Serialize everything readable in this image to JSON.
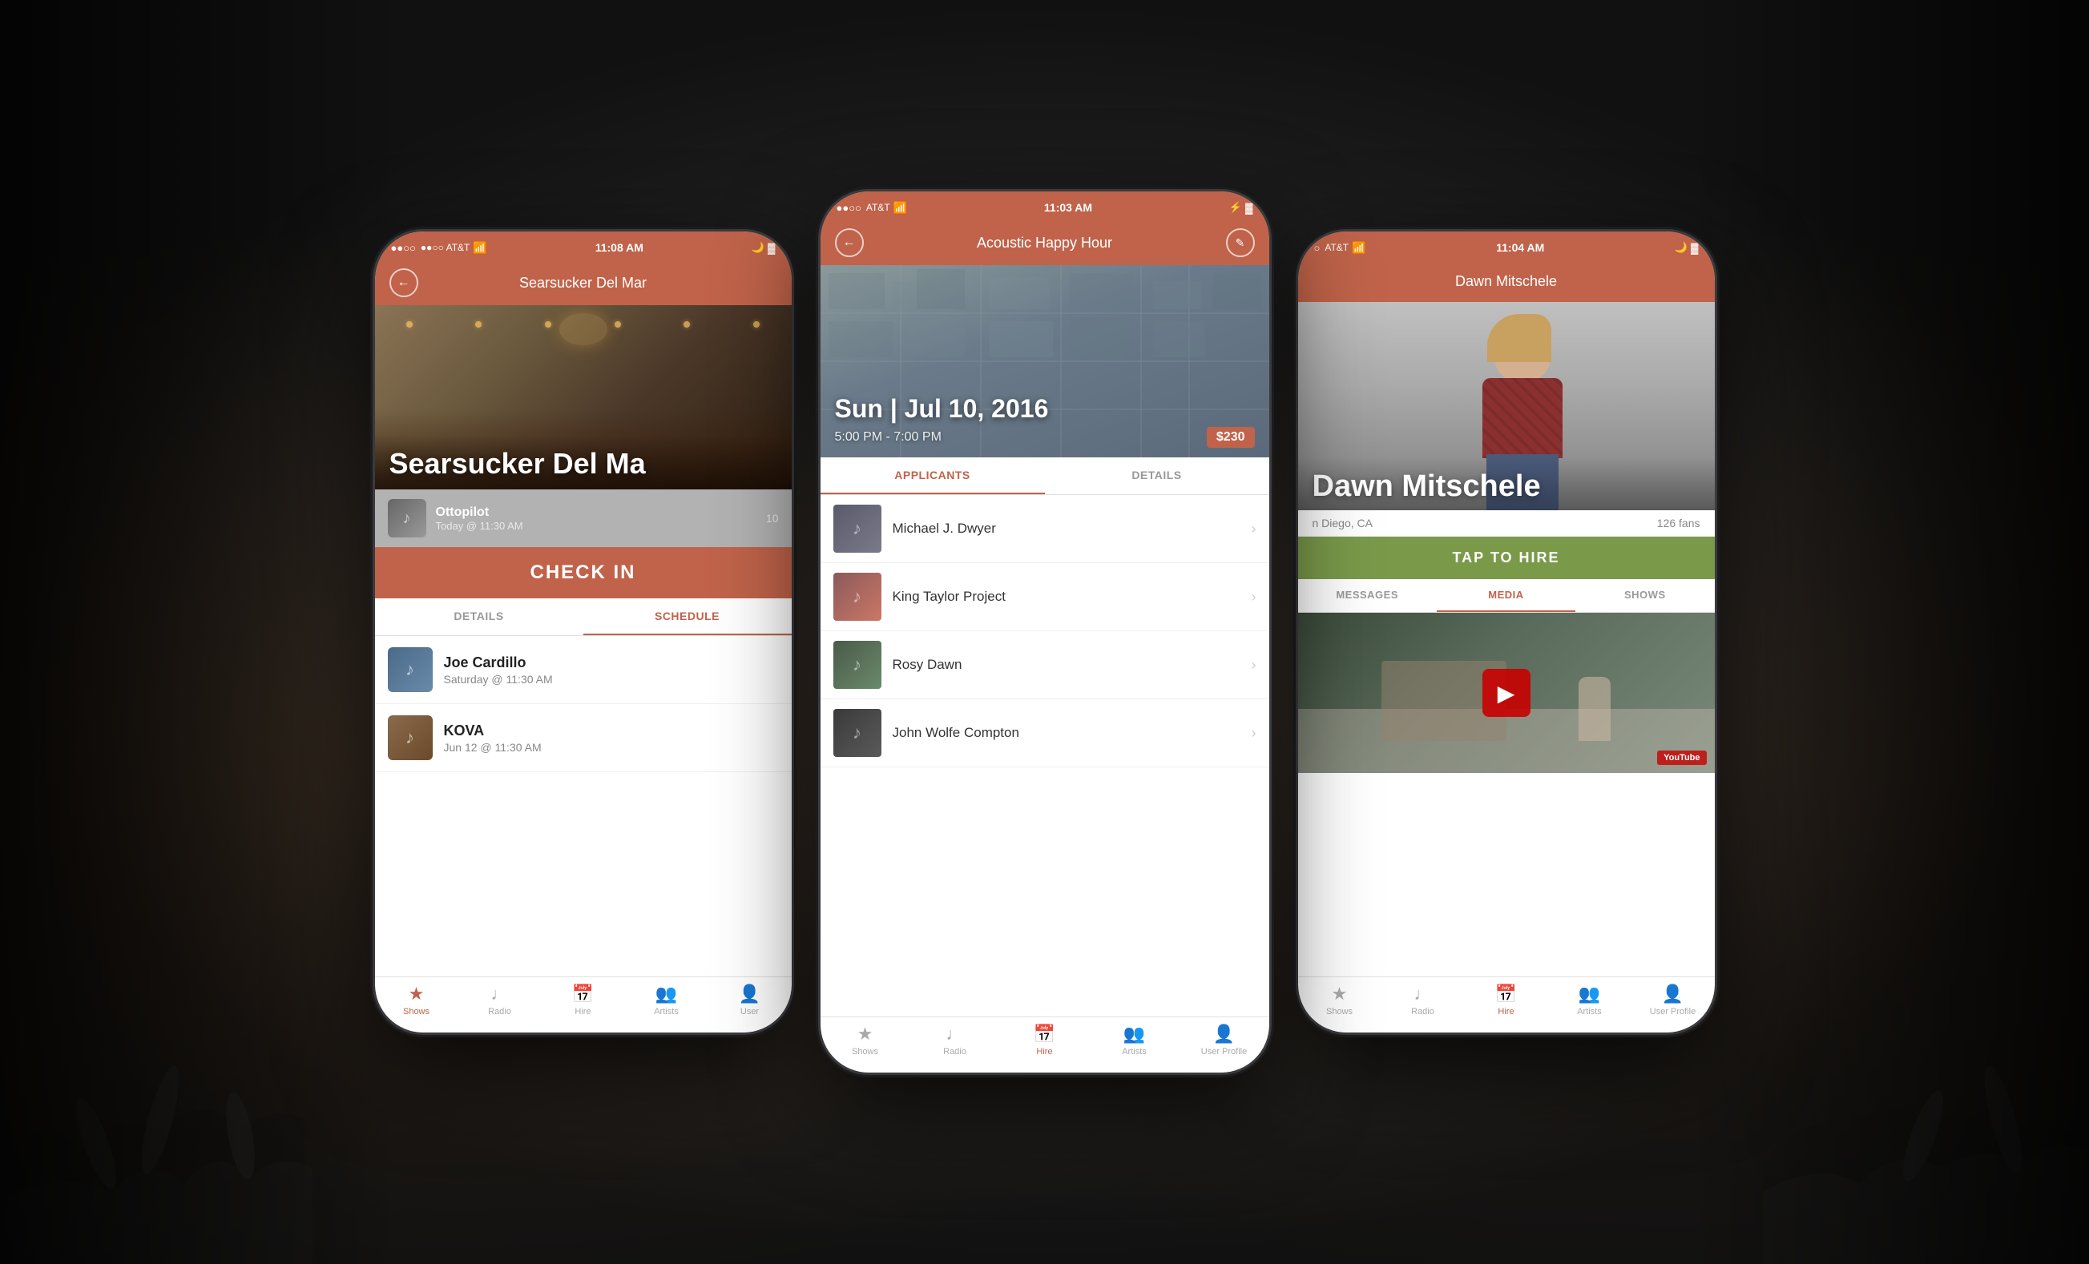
{
  "background": {
    "color": "#1a1a1a"
  },
  "phones": {
    "left": {
      "statusBar": {
        "carrier": "●●○○ AT&T",
        "wifi": "▲",
        "time": "11:08 AM",
        "battery": "🔋"
      },
      "navBar": {
        "backLabel": "←",
        "title": "Searsucker Del Mar"
      },
      "heroVenueName": "Searsucker Del Ma",
      "performerSection": {
        "name": "Ottopilot",
        "time": "Today @ 11:30 AM",
        "count": "10"
      },
      "checkInBtn": "CHECK IN",
      "tabs": [
        {
          "label": "DETAILS",
          "active": false
        },
        {
          "label": "SCHEDULE",
          "active": true
        }
      ],
      "scheduleItems": [
        {
          "name": "Joe Cardillo",
          "time": "Saturday @ 11:30 AM",
          "avatarClass": "cardillo"
        },
        {
          "name": "KOVA",
          "time": "Jun 12 @ 11:30 AM",
          "avatarClass": "kova"
        }
      ],
      "bottomNav": [
        {
          "icon": "★",
          "label": "Shows",
          "active": true
        },
        {
          "icon": "♪",
          "label": "Radio",
          "active": false
        },
        {
          "icon": "📅",
          "label": "Hire",
          "active": false
        },
        {
          "icon": "👥",
          "label": "Artists",
          "active": false
        },
        {
          "icon": "👤",
          "label": "User",
          "active": false
        }
      ]
    },
    "center": {
      "statusBar": {
        "carrier": "●●○○ AT&T",
        "wifi": "▲",
        "time": "11:03 AM",
        "bluetooth": "⚡",
        "battery": "🔋"
      },
      "navBar": {
        "backLabel": "←",
        "title": "Acoustic Happy Hour",
        "editLabel": "✏"
      },
      "eventDate": "Sun | Jul 10, 2016",
      "eventTime": "5:00 PM - 7:00 PM",
      "eventPrice": "$230",
      "tabs": [
        {
          "label": "APPLICANTS",
          "active": true
        },
        {
          "label": "DETAILS",
          "active": false
        }
      ],
      "applicants": [
        {
          "name": "Michael J. Dwyer",
          "avatarClass": "app-av-1"
        },
        {
          "name": "King Taylor Project",
          "avatarClass": "app-av-2-special"
        },
        {
          "name": "Rosy Dawn",
          "avatarClass": "app-av-3"
        },
        {
          "name": "John Wolfe Compton",
          "avatarClass": "app-av-4"
        }
      ],
      "bottomNav": [
        {
          "icon": "★",
          "label": "Shows",
          "active": false
        },
        {
          "icon": "♪",
          "label": "Radio",
          "active": false
        },
        {
          "icon": "📅",
          "label": "Hire",
          "active": true
        },
        {
          "icon": "👥",
          "label": "Artists",
          "active": false
        },
        {
          "icon": "👤",
          "label": "User Profile",
          "active": false
        }
      ]
    },
    "right": {
      "statusBar": {
        "carrier": "○ AT&T",
        "wifi": "▲",
        "time": "11:04 AM",
        "battery": "🔋"
      },
      "navBar": {
        "title": "Dawn Mitschele"
      },
      "artistName": "Dawn Mitschele",
      "artistLocation": "n Diego, CA",
      "artistFans": "126 fans",
      "tapHireBtn": "TAP TO HIRE",
      "mediaTabs": [
        {
          "label": "MESSAGES",
          "active": false
        },
        {
          "label": "MEDIA",
          "active": true
        },
        {
          "label": "SHOWS",
          "active": false
        }
      ],
      "bottomNav": [
        {
          "icon": "★",
          "label": "Shows",
          "active": false
        },
        {
          "icon": "♪",
          "label": "Radio",
          "active": false
        },
        {
          "icon": "📅",
          "label": "Hire",
          "active": true
        },
        {
          "icon": "👥",
          "label": "Artists",
          "active": false
        },
        {
          "icon": "👤",
          "label": "User Profile",
          "active": false
        }
      ]
    }
  }
}
